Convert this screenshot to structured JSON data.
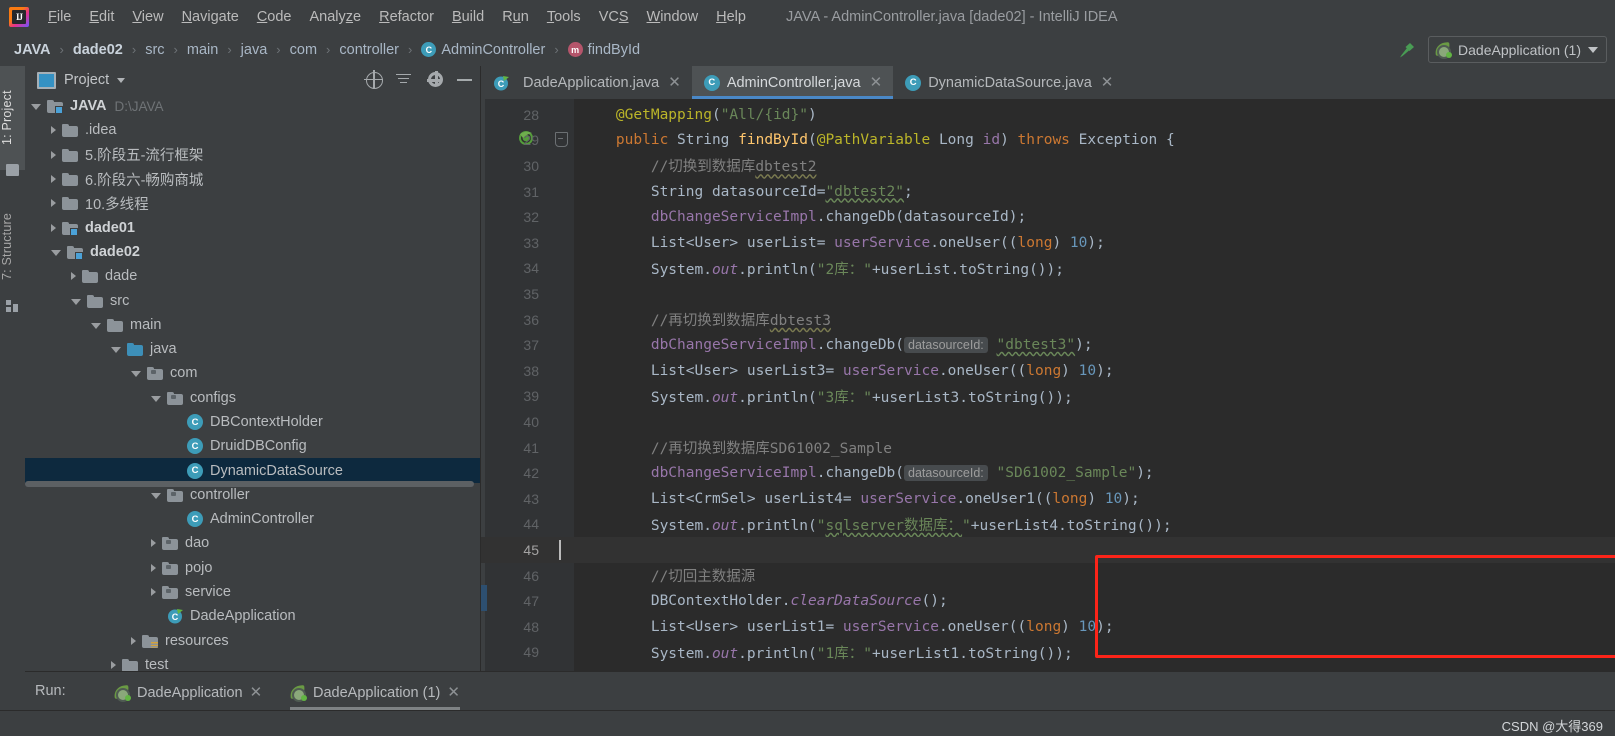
{
  "window": {
    "title": "JAVA - AdminController.java [dade02] - IntelliJ IDEA",
    "logo_icon": "intellij-idea-logo"
  },
  "menubar": {
    "items": [
      {
        "label": "File",
        "mnemonic": "F"
      },
      {
        "label": "Edit",
        "mnemonic": "E"
      },
      {
        "label": "View",
        "mnemonic": "V"
      },
      {
        "label": "Navigate",
        "mnemonic": "N"
      },
      {
        "label": "Code",
        "mnemonic": "C"
      },
      {
        "label": "Analyze",
        "mnemonic": "z"
      },
      {
        "label": "Refactor",
        "mnemonic": "R"
      },
      {
        "label": "Build",
        "mnemonic": "B"
      },
      {
        "label": "Run",
        "mnemonic": "u"
      },
      {
        "label": "Tools",
        "mnemonic": "T"
      },
      {
        "label": "VCS",
        "mnemonic": "S"
      },
      {
        "label": "Window",
        "mnemonic": "W"
      },
      {
        "label": "Help",
        "mnemonic": "H"
      }
    ]
  },
  "breadcrumb": {
    "separator": "›",
    "items": [
      {
        "label": "JAVA",
        "bold": true,
        "icon": ""
      },
      {
        "label": "dade02",
        "bold": true,
        "icon": ""
      },
      {
        "label": "src",
        "bold": false,
        "icon": ""
      },
      {
        "label": "main",
        "bold": false,
        "icon": ""
      },
      {
        "label": "java",
        "bold": false,
        "icon": ""
      },
      {
        "label": "com",
        "bold": false,
        "icon": ""
      },
      {
        "label": "controller",
        "bold": false,
        "icon": ""
      },
      {
        "label": "AdminController",
        "bold": false,
        "icon": "class-icon",
        "icon_letter": "C"
      },
      {
        "label": "findById",
        "bold": false,
        "icon": "method-icon",
        "icon_letter": "m"
      }
    ]
  },
  "toolbar_right": {
    "build_icon": "hammer-icon",
    "run_config": {
      "label": "DadeApplication (1)",
      "icon": "spring-boot-icon",
      "dropdown_icon": "chevron-down-icon"
    }
  },
  "tool_strip": {
    "tabs": [
      {
        "label": "1: Project",
        "active": true,
        "icon": "folder-icon"
      },
      {
        "label": "7: Structure",
        "active": false,
        "icon": "structure-icon"
      }
    ]
  },
  "project_panel": {
    "title": "Project",
    "view_icon": "project-view-icon",
    "dropdown_icon": "chevron-down-icon",
    "actions": [
      {
        "name": "locate-icon",
        "title": "Select Opened File"
      },
      {
        "name": "collapse-all-icon",
        "title": "Collapse All"
      },
      {
        "name": "gear-icon",
        "title": "Settings"
      },
      {
        "name": "minimize-icon",
        "title": "Hide"
      }
    ],
    "tree": [
      {
        "label": "JAVA",
        "path": "D:\\JAVA",
        "indent": 0,
        "twist": "open",
        "icon": "module-folder-icon",
        "bold": true,
        "selected": false
      },
      {
        "label": ".idea",
        "path": "",
        "indent": 1,
        "twist": "closed",
        "icon": "folder-icon",
        "bold": false,
        "selected": false
      },
      {
        "label": "5.阶段五-流行框架",
        "path": "",
        "indent": 1,
        "twist": "closed",
        "icon": "folder-icon",
        "bold": false,
        "selected": false
      },
      {
        "label": "6.阶段六-畅购商城",
        "path": "",
        "indent": 1,
        "twist": "closed",
        "icon": "folder-icon",
        "bold": false,
        "selected": false
      },
      {
        "label": "10.多线程",
        "path": "",
        "indent": 1,
        "twist": "closed",
        "icon": "folder-icon",
        "bold": false,
        "selected": false
      },
      {
        "label": "dade01",
        "path": "",
        "indent": 1,
        "twist": "closed",
        "icon": "module-folder-icon",
        "bold": true,
        "selected": false
      },
      {
        "label": "dade02",
        "path": "",
        "indent": 1,
        "twist": "open",
        "icon": "module-folder-icon",
        "bold": true,
        "selected": false
      },
      {
        "label": "dade",
        "path": "",
        "indent": 2,
        "twist": "closed",
        "icon": "folder-icon",
        "bold": false,
        "selected": false
      },
      {
        "label": "src",
        "path": "",
        "indent": 2,
        "twist": "open",
        "icon": "folder-icon",
        "bold": false,
        "selected": false
      },
      {
        "label": "main",
        "path": "",
        "indent": 3,
        "twist": "open",
        "icon": "folder-icon",
        "bold": false,
        "selected": false
      },
      {
        "label": "java",
        "path": "",
        "indent": 4,
        "twist": "open",
        "icon": "source-root-icon",
        "bold": false,
        "selected": false
      },
      {
        "label": "com",
        "path": "",
        "indent": 5,
        "twist": "open",
        "icon": "package-icon",
        "bold": false,
        "selected": false
      },
      {
        "label": "configs",
        "path": "",
        "indent": 6,
        "twist": "open",
        "icon": "package-icon",
        "bold": false,
        "selected": false
      },
      {
        "label": "DBContextHolder",
        "path": "",
        "indent": 7,
        "twist": "none",
        "icon": "class-icon",
        "bold": false,
        "selected": false
      },
      {
        "label": "DruidDBConfig",
        "path": "",
        "indent": 7,
        "twist": "none",
        "icon": "class-icon",
        "bold": false,
        "selected": false
      },
      {
        "label": "DynamicDataSource",
        "path": "",
        "indent": 7,
        "twist": "none",
        "icon": "class-icon",
        "bold": false,
        "selected": true
      },
      {
        "label": "controller",
        "path": "",
        "indent": 6,
        "twist": "open",
        "icon": "package-icon",
        "bold": false,
        "selected": false
      },
      {
        "label": "AdminController",
        "path": "",
        "indent": 7,
        "twist": "none",
        "icon": "class-icon",
        "bold": false,
        "selected": false
      },
      {
        "label": "dao",
        "path": "",
        "indent": 6,
        "twist": "closed",
        "icon": "package-icon",
        "bold": false,
        "selected": false
      },
      {
        "label": "pojo",
        "path": "",
        "indent": 6,
        "twist": "closed",
        "icon": "package-icon",
        "bold": false,
        "selected": false
      },
      {
        "label": "service",
        "path": "",
        "indent": 6,
        "twist": "closed",
        "icon": "package-icon",
        "bold": false,
        "selected": false
      },
      {
        "label": "DadeApplication",
        "path": "",
        "indent": 6,
        "twist": "none",
        "icon": "spring-class-icon",
        "bold": false,
        "selected": false
      },
      {
        "label": "resources",
        "path": "",
        "indent": 5,
        "twist": "closed",
        "icon": "resource-root-icon",
        "bold": false,
        "selected": false
      },
      {
        "label": "test",
        "path": "",
        "indent": 4,
        "twist": "closed",
        "icon": "folder-icon",
        "bold": false,
        "selected": false
      }
    ]
  },
  "editor_tabs": [
    {
      "label": "DadeApplication.java",
      "icon": "spring-class-icon",
      "active": false,
      "close_icon": "close-icon"
    },
    {
      "label": "AdminController.java",
      "icon": "class-icon",
      "active": true,
      "close_icon": "close-icon"
    },
    {
      "label": "DynamicDataSource.java",
      "icon": "class-icon",
      "active": false,
      "close_icon": "close-icon"
    }
  ],
  "editor": {
    "current_line": 45,
    "gutter_run_icon": "spring-run-icon",
    "fold_icon": "fold-region-icon",
    "lines": [
      {
        "n": 28,
        "tokens": [
          {
            "t": "    ",
            "c": ""
          },
          {
            "t": "@GetMapping",
            "c": "t-ann"
          },
          {
            "t": "(",
            "c": "t-def"
          },
          {
            "t": "\"All/{id}\"",
            "c": "t-str"
          },
          {
            "t": ")",
            "c": "t-def"
          }
        ]
      },
      {
        "n": 29,
        "tokens": [
          {
            "t": "    ",
            "c": ""
          },
          {
            "t": "public ",
            "c": "t-kw"
          },
          {
            "t": "String ",
            "c": "t-cls"
          },
          {
            "t": "findById",
            "c": "t-meth"
          },
          {
            "t": "(",
            "c": "t-def"
          },
          {
            "t": "@PathVariable ",
            "c": "t-ann"
          },
          {
            "t": "Long ",
            "c": "t-cls"
          },
          {
            "t": "id",
            "c": "t-fld"
          },
          {
            "t": ") ",
            "c": "t-def"
          },
          {
            "t": "throws ",
            "c": "t-kw"
          },
          {
            "t": "Exception {",
            "c": "t-cls"
          }
        ]
      },
      {
        "n": 30,
        "tokens": [
          {
            "t": "        ",
            "c": ""
          },
          {
            "t": "//切换到数据库",
            "c": "t-cmt"
          },
          {
            "t": "dbtest2",
            "c": "t-cmt sq-gray"
          }
        ]
      },
      {
        "n": 31,
        "tokens": [
          {
            "t": "        ",
            "c": ""
          },
          {
            "t": "String ",
            "c": "t-cls"
          },
          {
            "t": "datasourceId=",
            "c": "t-def"
          },
          {
            "t": "\"dbtest2\"",
            "c": "t-str sq-und"
          },
          {
            "t": ";",
            "c": "t-def"
          }
        ]
      },
      {
        "n": 32,
        "tokens": [
          {
            "t": "        ",
            "c": ""
          },
          {
            "t": "dbChangeServiceImpl",
            "c": "t-fld"
          },
          {
            "t": ".changeDb(datasourceId);",
            "c": "t-def"
          }
        ]
      },
      {
        "n": 33,
        "tokens": [
          {
            "t": "        ",
            "c": ""
          },
          {
            "t": "List<User> userList= ",
            "c": "t-def"
          },
          {
            "t": "userService",
            "c": "t-fld"
          },
          {
            "t": ".oneUser((",
            "c": "t-def"
          },
          {
            "t": "long",
            "c": "t-kw"
          },
          {
            "t": ") ",
            "c": "t-def"
          },
          {
            "t": "10",
            "c": "t-num"
          },
          {
            "t": ");",
            "c": "t-def"
          }
        ]
      },
      {
        "n": 34,
        "tokens": [
          {
            "t": "        ",
            "c": ""
          },
          {
            "t": "System.",
            "c": "t-def"
          },
          {
            "t": "out",
            "c": "t-stat"
          },
          {
            "t": ".println(",
            "c": "t-def"
          },
          {
            "t": "\"2库：\"",
            "c": "t-str"
          },
          {
            "t": "+userList.toString());",
            "c": "t-def"
          }
        ]
      },
      {
        "n": 35,
        "tokens": []
      },
      {
        "n": 36,
        "tokens": [
          {
            "t": "        ",
            "c": ""
          },
          {
            "t": "//再切换到数据库",
            "c": "t-cmt"
          },
          {
            "t": "dbtest3",
            "c": "t-cmt sq-gray"
          }
        ]
      },
      {
        "n": 37,
        "tokens": [
          {
            "t": "        ",
            "c": ""
          },
          {
            "t": "dbChangeServiceImpl",
            "c": "t-fld"
          },
          {
            "t": ".changeDb(",
            "c": "t-def"
          },
          {
            "t": "datasourceId:",
            "c": "t-hint"
          },
          {
            "t": " ",
            "c": ""
          },
          {
            "t": "\"dbtest3\"",
            "c": "t-str sq-und"
          },
          {
            "t": ");",
            "c": "t-def"
          }
        ]
      },
      {
        "n": 38,
        "tokens": [
          {
            "t": "        ",
            "c": ""
          },
          {
            "t": "List<User> userList3= ",
            "c": "t-def"
          },
          {
            "t": "userService",
            "c": "t-fld"
          },
          {
            "t": ".oneUser((",
            "c": "t-def"
          },
          {
            "t": "long",
            "c": "t-kw"
          },
          {
            "t": ") ",
            "c": "t-def"
          },
          {
            "t": "10",
            "c": "t-num"
          },
          {
            "t": ");",
            "c": "t-def"
          }
        ]
      },
      {
        "n": 39,
        "tokens": [
          {
            "t": "        ",
            "c": ""
          },
          {
            "t": "System.",
            "c": "t-def"
          },
          {
            "t": "out",
            "c": "t-stat"
          },
          {
            "t": ".println(",
            "c": "t-def"
          },
          {
            "t": "\"3库：\"",
            "c": "t-str"
          },
          {
            "t": "+userList3.toString());",
            "c": "t-def"
          }
        ]
      },
      {
        "n": 40,
        "tokens": []
      },
      {
        "n": 41,
        "tokens": [
          {
            "t": "        ",
            "c": ""
          },
          {
            "t": "//再切换到数据库SD61002_Sample",
            "c": "t-cmt"
          }
        ]
      },
      {
        "n": 42,
        "tokens": [
          {
            "t": "        ",
            "c": ""
          },
          {
            "t": "dbChangeServiceImpl",
            "c": "t-fld"
          },
          {
            "t": ".changeDb(",
            "c": "t-def"
          },
          {
            "t": "datasourceId:",
            "c": "t-hint"
          },
          {
            "t": " ",
            "c": ""
          },
          {
            "t": "\"SD61002_Sample\"",
            "c": "t-str"
          },
          {
            "t": ");",
            "c": "t-def"
          }
        ]
      },
      {
        "n": 43,
        "tokens": [
          {
            "t": "        ",
            "c": ""
          },
          {
            "t": "List<CrmSel> userList4= ",
            "c": "t-def"
          },
          {
            "t": "userService",
            "c": "t-fld"
          },
          {
            "t": ".oneUser1((",
            "c": "t-def"
          },
          {
            "t": "long",
            "c": "t-kw"
          },
          {
            "t": ") ",
            "c": "t-def"
          },
          {
            "t": "10",
            "c": "t-num"
          },
          {
            "t": ");",
            "c": "t-def"
          }
        ]
      },
      {
        "n": 44,
        "tokens": [
          {
            "t": "        ",
            "c": ""
          },
          {
            "t": "System.",
            "c": "t-def"
          },
          {
            "t": "out",
            "c": "t-stat"
          },
          {
            "t": ".println(",
            "c": "t-def"
          },
          {
            "t": "\"",
            "c": "t-str"
          },
          {
            "t": "sqlserver数据库：",
            "c": "t-str sq-und"
          },
          {
            "t": "\"",
            "c": "t-str"
          },
          {
            "t": "+userList4.toString());",
            "c": "t-def"
          }
        ]
      },
      {
        "n": 45,
        "tokens": []
      },
      {
        "n": 46,
        "tokens": [
          {
            "t": "        ",
            "c": ""
          },
          {
            "t": "//切回主数据源",
            "c": "t-cmt"
          }
        ]
      },
      {
        "n": 47,
        "tokens": [
          {
            "t": "        ",
            "c": ""
          },
          {
            "t": "DBContextHolder.",
            "c": "t-def"
          },
          {
            "t": "clearDataSource",
            "c": "t-stat"
          },
          {
            "t": "();",
            "c": "t-def"
          }
        ]
      },
      {
        "n": 48,
        "tokens": [
          {
            "t": "        ",
            "c": ""
          },
          {
            "t": "List<User> userList1= ",
            "c": "t-def"
          },
          {
            "t": "userService",
            "c": "t-fld"
          },
          {
            "t": ".oneUser((",
            "c": "t-def"
          },
          {
            "t": "long",
            "c": "t-kw"
          },
          {
            "t": ") ",
            "c": "t-def"
          },
          {
            "t": "10",
            "c": "t-num"
          },
          {
            "t": ");",
            "c": "t-def"
          }
        ]
      },
      {
        "n": 49,
        "tokens": [
          {
            "t": "        ",
            "c": ""
          },
          {
            "t": "System.",
            "c": "t-def"
          },
          {
            "t": "out",
            "c": "t-stat"
          },
          {
            "t": ".println(",
            "c": "t-def"
          },
          {
            "t": "\"1库：\"",
            "c": "t-str"
          },
          {
            "t": "+userList1.toString());",
            "c": "t-def"
          }
        ]
      }
    ],
    "annotation": {
      "type": "red-rectangle-highlight",
      "color": "#fc2419",
      "covers_lines": [
        42,
        43,
        44,
        45
      ]
    }
  },
  "run_panel": {
    "label": "Run:",
    "tabs": [
      {
        "label": "DadeApplication",
        "icon": "spring-boot-icon",
        "active": false,
        "close_icon": "close-icon"
      },
      {
        "label": "DadeApplication (1)",
        "icon": "spring-boot-icon",
        "active": true,
        "close_icon": "close-icon"
      }
    ]
  },
  "status_bar": {
    "watermark": "CSDN @大得369"
  }
}
